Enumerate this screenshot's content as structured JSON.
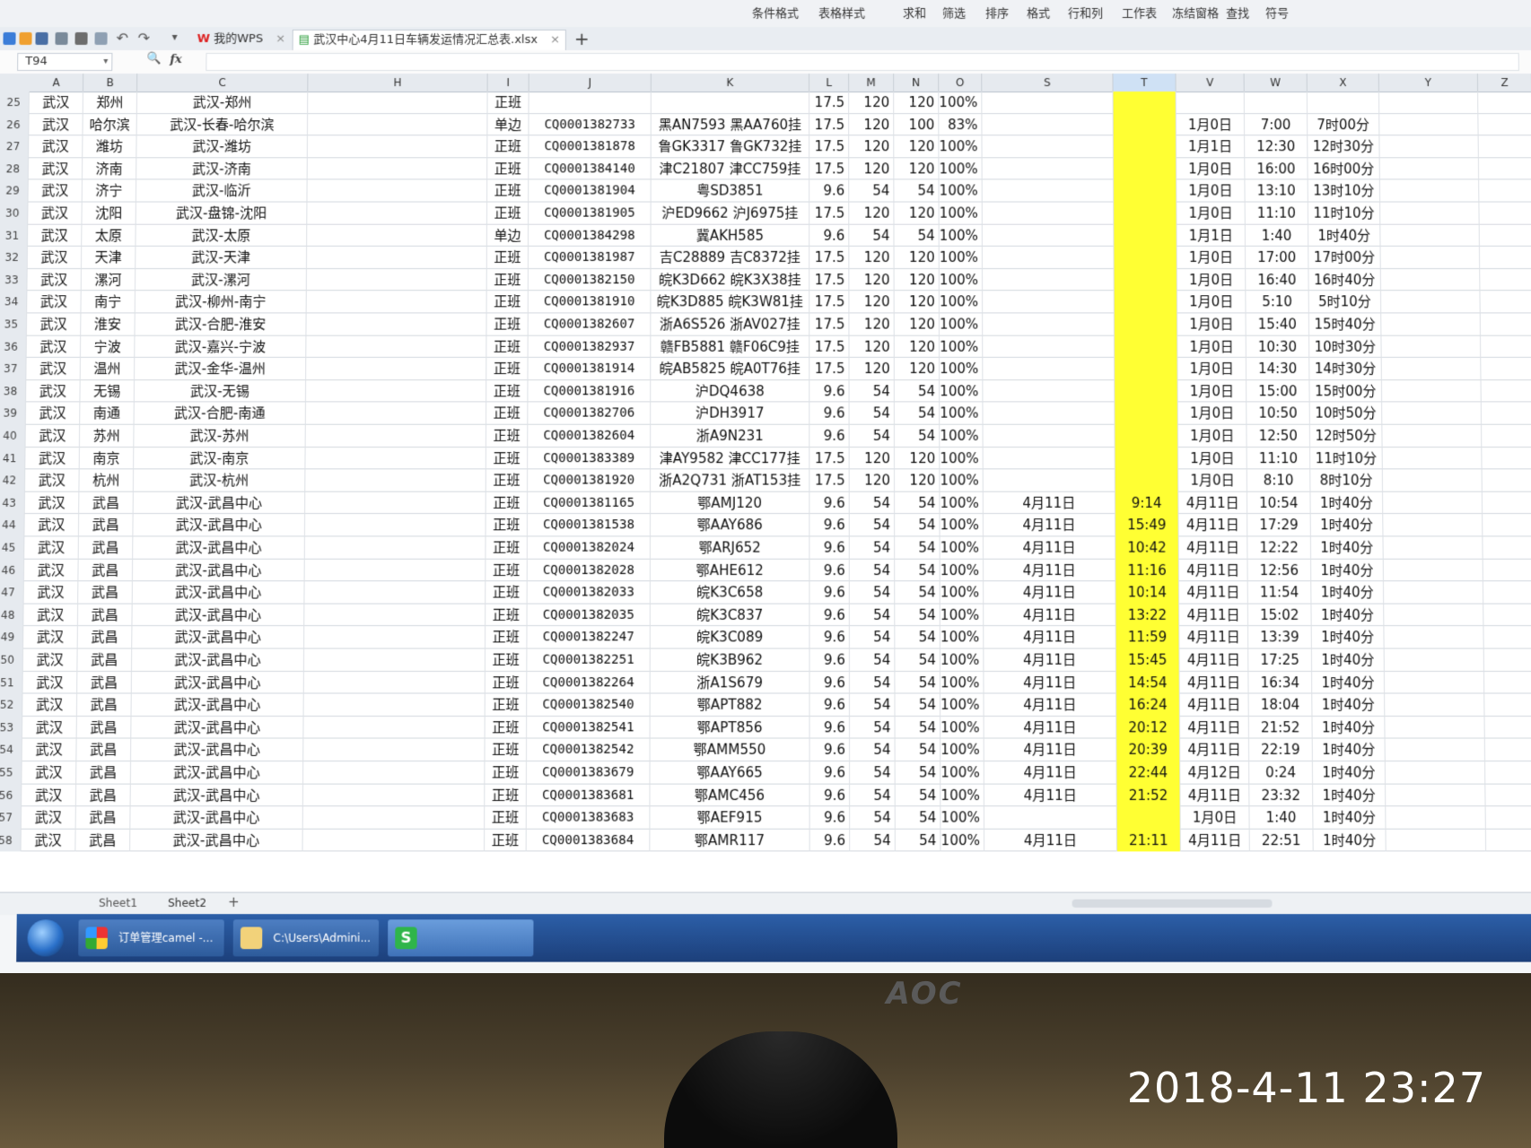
{
  "ribbon": {
    "items": [
      "条件格式",
      "表格样式",
      "求和",
      "筛选",
      "排序",
      "格式",
      "行和列",
      "工作表",
      "冻结窗格",
      "查找",
      "符号"
    ]
  },
  "tabs": {
    "home_label": "我的WPS",
    "file_label": "武汉中心4月11日车辆发运情况汇总表.xlsx",
    "add_symbol": "+"
  },
  "formula_bar": {
    "cell_ref": "T94",
    "fx": "fx"
  },
  "columns": [
    "A",
    "B",
    "C",
    "H",
    "I",
    "J",
    "K",
    "L",
    "M",
    "N",
    "O",
    "S",
    "T",
    "V",
    "W",
    "X",
    "Y",
    "Z"
  ],
  "rows": [
    {
      "n": "25",
      "a": "武汉",
      "b": "郑州",
      "c": "武汉-郑州",
      "i": "正班",
      "j": "",
      "k": "",
      "l": "17.5",
      "m": "120",
      "nn": "120",
      "o": "100%",
      "s": "",
      "t": "",
      "v": "",
      "w": "",
      "x": ""
    },
    {
      "n": "26",
      "a": "武汉",
      "b": "哈尔滨",
      "c": "武汉-长春-哈尔滨",
      "i": "单边",
      "j": "CQ0001382733",
      "k": "黑AN7593 黑AA760挂",
      "l": "17.5",
      "m": "120",
      "nn": "100",
      "o": "83%",
      "s": "",
      "t": "",
      "v": "1月0日",
      "w": "7:00",
      "x": "7时00分"
    },
    {
      "n": "27",
      "a": "武汉",
      "b": "潍坊",
      "c": "武汉-潍坊",
      "i": "正班",
      "j": "CQ0001381878",
      "k": "鲁GK3317 鲁GK732挂",
      "l": "17.5",
      "m": "120",
      "nn": "120",
      "o": "100%",
      "s": "",
      "t": "",
      "v": "1月1日",
      "w": "12:30",
      "x": "12时30分"
    },
    {
      "n": "28",
      "a": "武汉",
      "b": "济南",
      "c": "武汉-济南",
      "i": "正班",
      "j": "CQ0001384140",
      "k": "津C21807 津CC759挂",
      "l": "17.5",
      "m": "120",
      "nn": "120",
      "o": "100%",
      "s": "",
      "t": "",
      "v": "1月0日",
      "w": "16:00",
      "x": "16时00分"
    },
    {
      "n": "29",
      "a": "武汉",
      "b": "济宁",
      "c": "武汉-临沂",
      "i": "正班",
      "j": "CQ0001381904",
      "k": "粤SD3851",
      "l": "9.6",
      "m": "54",
      "nn": "54",
      "o": "100%",
      "s": "",
      "t": "",
      "v": "1月0日",
      "w": "13:10",
      "x": "13时10分"
    },
    {
      "n": "30",
      "a": "武汉",
      "b": "沈阳",
      "c": "武汉-盘锦-沈阳",
      "i": "正班",
      "j": "CQ0001381905",
      "k": "沪ED9662 沪J6975挂",
      "l": "17.5",
      "m": "120",
      "nn": "120",
      "o": "100%",
      "s": "",
      "t": "",
      "v": "1月0日",
      "w": "11:10",
      "x": "11时10分"
    },
    {
      "n": "31",
      "a": "武汉",
      "b": "太原",
      "c": "武汉-太原",
      "i": "单边",
      "j": "CQ0001384298",
      "k": "冀AKH585",
      "l": "9.6",
      "m": "54",
      "nn": "54",
      "o": "100%",
      "s": "",
      "t": "",
      "v": "1月1日",
      "w": "1:40",
      "x": "1时40分"
    },
    {
      "n": "32",
      "a": "武汉",
      "b": "天津",
      "c": "武汉-天津",
      "i": "正班",
      "j": "CQ0001381987",
      "k": "吉C28889 吉C8372挂",
      "l": "17.5",
      "m": "120",
      "nn": "120",
      "o": "100%",
      "s": "",
      "t": "",
      "v": "1月0日",
      "w": "17:00",
      "x": "17时00分"
    },
    {
      "n": "33",
      "a": "武汉",
      "b": "漯河",
      "c": "武汉-漯河",
      "i": "正班",
      "j": "CQ0001382150",
      "k": "皖K3D662 皖K3X38挂",
      "l": "17.5",
      "m": "120",
      "nn": "120",
      "o": "100%",
      "s": "",
      "t": "",
      "v": "1月0日",
      "w": "16:40",
      "x": "16时40分"
    },
    {
      "n": "34",
      "a": "武汉",
      "b": "南宁",
      "c": "武汉-柳州-南宁",
      "i": "正班",
      "j": "CQ0001381910",
      "k": "皖K3D885 皖K3W81挂",
      "l": "17.5",
      "m": "120",
      "nn": "120",
      "o": "100%",
      "s": "",
      "t": "",
      "v": "1月0日",
      "w": "5:10",
      "x": "5时10分"
    },
    {
      "n": "35",
      "a": "武汉",
      "b": "淮安",
      "c": "武汉-合肥-淮安",
      "i": "正班",
      "j": "CQ0001382607",
      "k": "浙A6S526 浙AV027挂",
      "l": "17.5",
      "m": "120",
      "nn": "120",
      "o": "100%",
      "s": "",
      "t": "",
      "v": "1月0日",
      "w": "15:40",
      "x": "15时40分"
    },
    {
      "n": "36",
      "a": "武汉",
      "b": "宁波",
      "c": "武汉-嘉兴-宁波",
      "i": "正班",
      "j": "CQ0001382937",
      "k": "赣FB5881 赣F06C9挂",
      "l": "17.5",
      "m": "120",
      "nn": "120",
      "o": "100%",
      "s": "",
      "t": "",
      "v": "1月0日",
      "w": "10:30",
      "x": "10时30分"
    },
    {
      "n": "37",
      "a": "武汉",
      "b": "温州",
      "c": "武汉-金华-温州",
      "i": "正班",
      "j": "CQ0001381914",
      "k": "皖AB5825 皖A0T76挂",
      "l": "17.5",
      "m": "120",
      "nn": "120",
      "o": "100%",
      "s": "",
      "t": "",
      "v": "1月0日",
      "w": "14:30",
      "x": "14时30分"
    },
    {
      "n": "38",
      "a": "武汉",
      "b": "无锡",
      "c": "武汉-无锡",
      "i": "正班",
      "j": "CQ0001381916",
      "k": "沪DQ4638",
      "l": "9.6",
      "m": "54",
      "nn": "54",
      "o": "100%",
      "s": "",
      "t": "",
      "v": "1月0日",
      "w": "15:00",
      "x": "15时00分"
    },
    {
      "n": "39",
      "a": "武汉",
      "b": "南通",
      "c": "武汉-合肥-南通",
      "i": "正班",
      "j": "CQ0001382706",
      "k": "沪DH3917",
      "l": "9.6",
      "m": "54",
      "nn": "54",
      "o": "100%",
      "s": "",
      "t": "",
      "v": "1月0日",
      "w": "10:50",
      "x": "10时50分"
    },
    {
      "n": "40",
      "a": "武汉",
      "b": "苏州",
      "c": "武汉-苏州",
      "i": "正班",
      "j": "CQ0001382604",
      "k": "浙A9N231",
      "l": "9.6",
      "m": "54",
      "nn": "54",
      "o": "100%",
      "s": "",
      "t": "",
      "v": "1月0日",
      "w": "12:50",
      "x": "12时50分"
    },
    {
      "n": "41",
      "a": "武汉",
      "b": "南京",
      "c": "武汉-南京",
      "i": "正班",
      "j": "CQ0001383389",
      "k": "津AY9582 津CC177挂",
      "l": "17.5",
      "m": "120",
      "nn": "120",
      "o": "100%",
      "s": "",
      "t": "",
      "v": "1月0日",
      "w": "11:10",
      "x": "11时10分"
    },
    {
      "n": "42",
      "a": "武汉",
      "b": "杭州",
      "c": "武汉-杭州",
      "i": "正班",
      "j": "CQ0001381920",
      "k": "浙A2Q731 浙AT153挂",
      "l": "17.5",
      "m": "120",
      "nn": "120",
      "o": "100%",
      "s": "",
      "t": "",
      "v": "1月0日",
      "w": "8:10",
      "x": "8时10分"
    },
    {
      "n": "43",
      "a": "武汉",
      "b": "武昌",
      "c": "武汉-武昌中心",
      "i": "正班",
      "j": "CQ0001381165",
      "k": "鄂AMJ120",
      "l": "9.6",
      "m": "54",
      "nn": "54",
      "o": "100%",
      "s": "4月11日",
      "t": "9:14",
      "v": "4月11日",
      "w": "10:54",
      "x": "1时40分"
    },
    {
      "n": "44",
      "a": "武汉",
      "b": "武昌",
      "c": "武汉-武昌中心",
      "i": "正班",
      "j": "CQ0001381538",
      "k": "鄂AAY686",
      "l": "9.6",
      "m": "54",
      "nn": "54",
      "o": "100%",
      "s": "4月11日",
      "t": "15:49",
      "v": "4月11日",
      "w": "17:29",
      "x": "1时40分"
    },
    {
      "n": "45",
      "a": "武汉",
      "b": "武昌",
      "c": "武汉-武昌中心",
      "i": "正班",
      "j": "CQ0001382024",
      "k": "鄂ARJ652",
      "l": "9.6",
      "m": "54",
      "nn": "54",
      "o": "100%",
      "s": "4月11日",
      "t": "10:42",
      "v": "4月11日",
      "w": "12:22",
      "x": "1时40分"
    },
    {
      "n": "46",
      "a": "武汉",
      "b": "武昌",
      "c": "武汉-武昌中心",
      "i": "正班",
      "j": "CQ0001382028",
      "k": "鄂AHE612",
      "l": "9.6",
      "m": "54",
      "nn": "54",
      "o": "100%",
      "s": "4月11日",
      "t": "11:16",
      "v": "4月11日",
      "w": "12:56",
      "x": "1时40分"
    },
    {
      "n": "47",
      "a": "武汉",
      "b": "武昌",
      "c": "武汉-武昌中心",
      "i": "正班",
      "j": "CQ0001382033",
      "k": "皖K3C658",
      "l": "9.6",
      "m": "54",
      "nn": "54",
      "o": "100%",
      "s": "4月11日",
      "t": "10:14",
      "v": "4月11日",
      "w": "11:54",
      "x": "1时40分"
    },
    {
      "n": "48",
      "a": "武汉",
      "b": "武昌",
      "c": "武汉-武昌中心",
      "i": "正班",
      "j": "CQ0001382035",
      "k": "皖K3C837",
      "l": "9.6",
      "m": "54",
      "nn": "54",
      "o": "100%",
      "s": "4月11日",
      "t": "13:22",
      "v": "4月11日",
      "w": "15:02",
      "x": "1时40分"
    },
    {
      "n": "49",
      "a": "武汉",
      "b": "武昌",
      "c": "武汉-武昌中心",
      "i": "正班",
      "j": "CQ0001382247",
      "k": "皖K3C089",
      "l": "9.6",
      "m": "54",
      "nn": "54",
      "o": "100%",
      "s": "4月11日",
      "t": "11:59",
      "v": "4月11日",
      "w": "13:39",
      "x": "1时40分"
    },
    {
      "n": "50",
      "a": "武汉",
      "b": "武昌",
      "c": "武汉-武昌中心",
      "i": "正班",
      "j": "CQ0001382251",
      "k": "皖K3B962",
      "l": "9.6",
      "m": "54",
      "nn": "54",
      "o": "100%",
      "s": "4月11日",
      "t": "15:45",
      "v": "4月11日",
      "w": "17:25",
      "x": "1时40分"
    },
    {
      "n": "51",
      "a": "武汉",
      "b": "武昌",
      "c": "武汉-武昌中心",
      "i": "正班",
      "j": "CQ0001382264",
      "k": "浙A1S679",
      "l": "9.6",
      "m": "54",
      "nn": "54",
      "o": "100%",
      "s": "4月11日",
      "t": "14:54",
      "v": "4月11日",
      "w": "16:34",
      "x": "1时40分"
    },
    {
      "n": "52",
      "a": "武汉",
      "b": "武昌",
      "c": "武汉-武昌中心",
      "i": "正班",
      "j": "CQ0001382540",
      "k": "鄂APT882",
      "l": "9.6",
      "m": "54",
      "nn": "54",
      "o": "100%",
      "s": "4月11日",
      "t": "16:24",
      "v": "4月11日",
      "w": "18:04",
      "x": "1时40分"
    },
    {
      "n": "53",
      "a": "武汉",
      "b": "武昌",
      "c": "武汉-武昌中心",
      "i": "正班",
      "j": "CQ0001382541",
      "k": "鄂APT856",
      "l": "9.6",
      "m": "54",
      "nn": "54",
      "o": "100%",
      "s": "4月11日",
      "t": "20:12",
      "v": "4月11日",
      "w": "21:52",
      "x": "1时40分"
    },
    {
      "n": "54",
      "a": "武汉",
      "b": "武昌",
      "c": "武汉-武昌中心",
      "i": "正班",
      "j": "CQ0001382542",
      "k": "鄂AMM550",
      "l": "9.6",
      "m": "54",
      "nn": "54",
      "o": "100%",
      "s": "4月11日",
      "t": "20:39",
      "v": "4月11日",
      "w": "22:19",
      "x": "1时40分"
    },
    {
      "n": "55",
      "a": "武汉",
      "b": "武昌",
      "c": "武汉-武昌中心",
      "i": "正班",
      "j": "CQ0001383679",
      "k": "鄂AAY665",
      "l": "9.6",
      "m": "54",
      "nn": "54",
      "o": "100%",
      "s": "4月11日",
      "t": "22:44",
      "v": "4月12日",
      "w": "0:24",
      "x": "1时40分"
    },
    {
      "n": "56",
      "a": "武汉",
      "b": "武昌",
      "c": "武汉-武昌中心",
      "i": "正班",
      "j": "CQ0001383681",
      "k": "鄂AMC456",
      "l": "9.6",
      "m": "54",
      "nn": "54",
      "o": "100%",
      "s": "4月11日",
      "t": "21:52",
      "v": "4月11日",
      "w": "23:32",
      "x": "1时40分"
    },
    {
      "n": "57",
      "a": "武汉",
      "b": "武昌",
      "c": "武汉-武昌中心",
      "i": "正班",
      "j": "CQ0001383683",
      "k": "鄂AEF915",
      "l": "9.6",
      "m": "54",
      "nn": "54",
      "o": "100%",
      "s": "",
      "t": "",
      "v": "1月0日",
      "w": "1:40",
      "x": "1时40分"
    },
    {
      "n": "58",
      "a": "武汉",
      "b": "武昌",
      "c": "武汉-武昌中心",
      "i": "正班",
      "j": "CQ0001383684",
      "k": "鄂AMR117",
      "l": "9.6",
      "m": "54",
      "nn": "54",
      "o": "100%",
      "s": "4月11日",
      "t": "21:11",
      "v": "4月11日",
      "w": "22:51",
      "x": "1时40分"
    }
  ],
  "sheets": {
    "sheet1": "Sheet1",
    "sheet2": "Sheet2",
    "add": "+"
  },
  "taskbar": {
    "items": [
      {
        "label": "订单管理camel -..."
      },
      {
        "label": "C:\\Users\\Admini..."
      },
      {
        "label": ""
      }
    ]
  },
  "monitor": {
    "brand": "AOC"
  },
  "photo_timestamp": "2018-4-11 23:27",
  "colors": {
    "highlight": "#ffff33",
    "wps_green": "#3cb54a",
    "taskbar": "#2c5fa8"
  }
}
